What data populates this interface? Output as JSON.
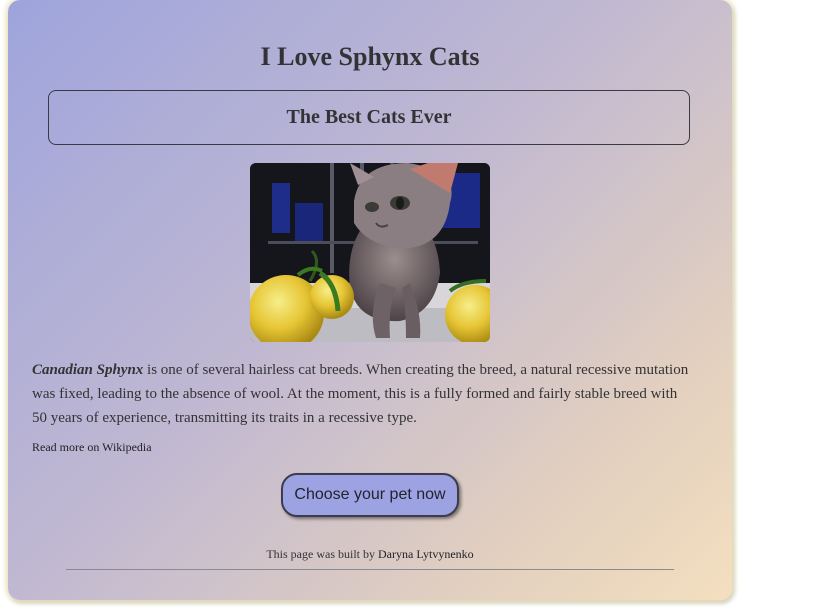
{
  "page": {
    "title": "I Love Sphynx Cats",
    "subtitle": "The Best Cats Ever"
  },
  "photo": {
    "subject": "sphynx-cat-with-citrus-fruits"
  },
  "description": {
    "lead": "Canadian Sphynx",
    "body": " is one of several hairless cat breeds. When creating the breed, a natural recessive mutation was fixed, leading to the absence of wool. At the moment, this is a fully formed and fairly stable breed with 50 years of experience, transmitting its traits in a recessive type."
  },
  "links": {
    "read_more": "Read more on Wikipedia"
  },
  "cta": {
    "label": "Choose your pet now"
  },
  "footer": {
    "prefix": "This page was built by ",
    "author": "Daryna Lytvynenko"
  },
  "colors": {
    "gradient_start": "#9ea4dc",
    "gradient_end": "#f4dfbf",
    "button": "#9ca2e2",
    "text": "#333336"
  }
}
